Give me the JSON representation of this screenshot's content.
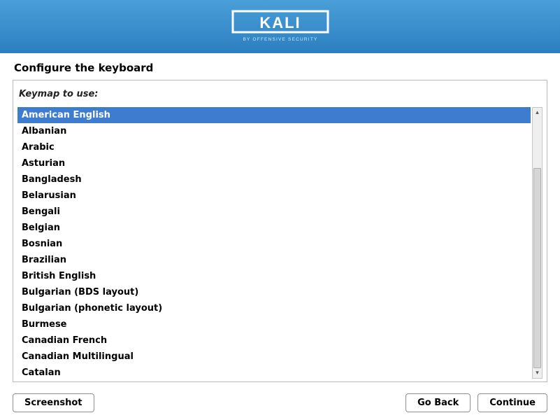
{
  "header": {
    "brand": "KALI",
    "subtitle": "BY OFFENSIVE SECURITY"
  },
  "page_title": "Configure the keyboard",
  "list_label": "Keymap to use:",
  "selected_index": 0,
  "keymaps": [
    "American English",
    "Albanian",
    "Arabic",
    "Asturian",
    "Bangladesh",
    "Belarusian",
    "Bengali",
    "Belgian",
    "Bosnian",
    "Brazilian",
    "British English",
    "Bulgarian (BDS layout)",
    "Bulgarian (phonetic layout)",
    "Burmese",
    "Canadian French",
    "Canadian Multilingual",
    "Catalan"
  ],
  "buttons": {
    "screenshot": "Screenshot",
    "go_back": "Go Back",
    "continue": "Continue"
  }
}
